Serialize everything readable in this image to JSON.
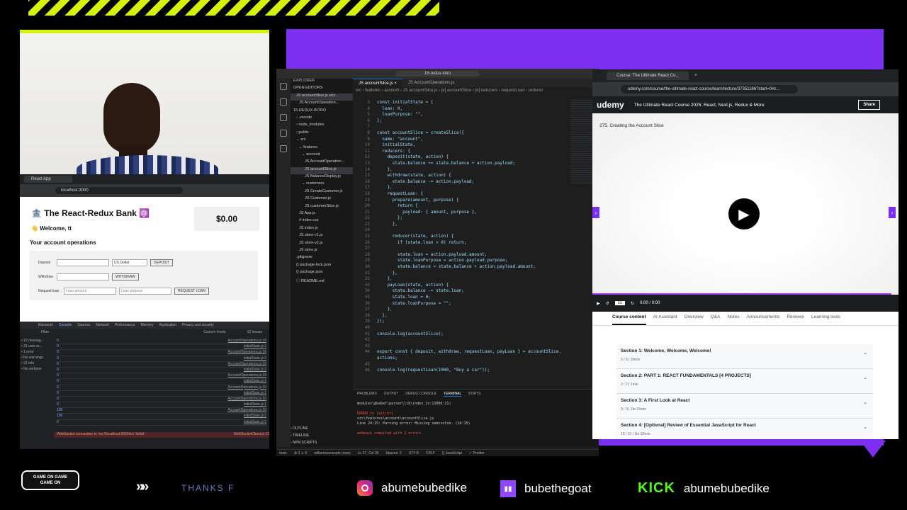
{
  "react_app": {
    "tab_title": "React App",
    "url": "localhost:3000",
    "heading": "🏦 The React-Redux Bank ⚛️",
    "welcome": "👋 Welcome, tt",
    "ops_title": "Your account operations",
    "balance": "$0.00",
    "deposit_label": "Deposit",
    "currency": "US Dollar",
    "deposit_btn": "DEPOSIT",
    "withdraw_label": "Withdraw",
    "withdraw_btn": "WITHDRAW",
    "loan_label": "Request loan",
    "loan_amount_ph": "Loan amount",
    "loan_purpose_ph": "Loan purpose",
    "loan_btn": "REQUEST LOAN"
  },
  "devtools": {
    "tabs": [
      "Elements",
      "Console",
      "Sources",
      "Network",
      "Performance",
      "Memory",
      "Application",
      "Privacy and security"
    ],
    "filter_placeholder": "Filter",
    "levels": "Custom levels",
    "issues": "12 Issues",
    "sidebar": [
      "22 messag...",
      "21 user m...",
      "1 error",
      "No warnings",
      "21 info",
      "No verbose"
    ],
    "log_rows": [
      {
        "v": "0",
        "src": "AccountOperations.js:16"
      },
      {
        "v": "0",
        "src": "initialState.js:1"
      },
      {
        "v": "0",
        "src": "AccountOperations.js:16"
      },
      {
        "v": "0",
        "src": "initialState.js:1"
      },
      {
        "v": "0",
        "src": "AccountOperations.js:16"
      },
      {
        "v": "0",
        "src": "initialState.js:1"
      },
      {
        "v": "0",
        "src": "AccountOperations.js:16"
      },
      {
        "v": "0",
        "src": "initialState.js:1"
      },
      {
        "v": "0",
        "src": "AccountOperations.js:16"
      },
      {
        "v": "0",
        "src": "initialState.js:1"
      },
      {
        "v": "0",
        "src": "AccountOperations.js:16"
      },
      {
        "v": "0",
        "src": "initialState.js:1"
      },
      {
        "v": "100",
        "src": "AccountOperations.js:16"
      },
      {
        "v": "100",
        "src": "initialState.js:1"
      },
      {
        "v": "0",
        "src": "initialState.js:1"
      }
    ],
    "error": "WebSocket connection to 'ws://localhost:3000/ws' failed:",
    "error_src": "WebSocketClient.js:13"
  },
  "vscode": {
    "search": "15-redux-intro",
    "explorer_title": "EXPLORER",
    "tree": [
      {
        "t": "OPEN EDITORS",
        "i": 0
      },
      {
        "t": "JS accountSlice.js src/...",
        "i": 1,
        "sel": true
      },
      {
        "t": "JS AccountOperation...",
        "i": 2
      },
      {
        "t": "15-REDUX-INTRO",
        "i": 0
      },
      {
        "t": "› .vscode",
        "i": 1
      },
      {
        "t": "› node_modules",
        "i": 1
      },
      {
        "t": "› public",
        "i": 1
      },
      {
        "t": "⌄ src",
        "i": 1
      },
      {
        "t": "⌄ features",
        "i": 2
      },
      {
        "t": "⌄ account",
        "i": 3
      },
      {
        "t": "JS AccountOperation...",
        "i": 4
      },
      {
        "t": "JS accountSlice.js",
        "i": 4,
        "sel": true
      },
      {
        "t": "JS BalanceDisplay.js",
        "i": 4
      },
      {
        "t": "⌄ customers",
        "i": 3
      },
      {
        "t": "JS CreateCustomer.js",
        "i": 4
      },
      {
        "t": "JS Customer.js",
        "i": 4
      },
      {
        "t": "JS customerSlice.js",
        "i": 4
      },
      {
        "t": "JS App.js",
        "i": 2
      },
      {
        "t": "# index.css",
        "i": 2
      },
      {
        "t": "JS index.js",
        "i": 2
      },
      {
        "t": "JS store-v1.js",
        "i": 2
      },
      {
        "t": "JS store-v2.js",
        "i": 2
      },
      {
        "t": "JS store.js",
        "i": 2
      },
      {
        "t": ".gitignore",
        "i": 1
      },
      {
        "t": "{} package-lock.json",
        "i": 1
      },
      {
        "t": "{} package.json",
        "i": 1
      },
      {
        "t": "ⓘ README.md",
        "i": 1
      }
    ],
    "tabs": [
      "JS accountSlice.js ×",
      "JS AccountOperations.js"
    ],
    "breadcrumb": "src › features › account › JS accountSlice.js › [e] accountSlice › [e] reducers › requestLoan › reducer",
    "code": [
      [
        "3",
        "const initialState = {"
      ],
      [
        "4",
        "  loan: 0,"
      ],
      [
        "5",
        "  loanPurpose: \"\","
      ],
      [
        "6",
        "};"
      ],
      [
        "7",
        ""
      ],
      [
        "8",
        "const accountSlice = createSlice({"
      ],
      [
        "9",
        "  name: \"account\","
      ],
      [
        "10",
        "  initialState,"
      ],
      [
        "11",
        "  reducers: {"
      ],
      [
        "12",
        "    deposit(state, action) {"
      ],
      [
        "13",
        "      state.balance += state.balance + action.payload;"
      ],
      [
        "14",
        "    },"
      ],
      [
        "15",
        "    withdraw(state, action) {"
      ],
      [
        "16",
        "      state.balance -= action.payload;"
      ],
      [
        "17",
        "    },"
      ],
      [
        "18",
        "    requestLoan: {"
      ],
      [
        "19",
        "      prepare(amount, purpose) {"
      ],
      [
        "20",
        "        return {"
      ],
      [
        "21",
        "          payload: { amount, purpose },"
      ],
      [
        "22",
        "        };"
      ],
      [
        "23",
        "      },"
      ],
      [
        "24",
        ""
      ],
      [
        "25",
        "      reducer(state, action) {"
      ],
      [
        "26",
        "        if (state.loan > 0) return;"
      ],
      [
        "27",
        ""
      ],
      [
        "28",
        "        state.loan = action.payload.amount;"
      ],
      [
        "29",
        "        state.loanPurpose = action.payload.purpose;"
      ],
      [
        "30",
        "        state.balance = state.balance + action.payload.amount;"
      ],
      [
        "31",
        "      },"
      ],
      [
        "32",
        "    },"
      ],
      [
        "33",
        "    payLoan(state, action) {"
      ],
      [
        "34",
        "      state.balance -= state.loan;"
      ],
      [
        "35",
        "      state.loan = 0;"
      ],
      [
        "36",
        "      state.loanPurpose = \"\";"
      ],
      [
        "37",
        "    },"
      ],
      [
        "38",
        "  },"
      ],
      [
        "39",
        "});"
      ],
      [
        "40",
        ""
      ],
      [
        "41",
        "console.log(accountSlice);"
      ],
      [
        "42",
        ""
      ],
      [
        "43",
        ""
      ],
      [
        "44",
        "export const { deposit, withdraw, requestLoan, payLoan } = accountSlice."
      ],
      [
        "",
        "actions;"
      ],
      [
        "45",
        ""
      ],
      [
        "46",
        "console.log(requestLoan(1000, \"Buy a car\"));"
      ]
    ],
    "panel_tabs": [
      "PROBLEMS",
      "OUTPUT",
      "DEBUG CONSOLE",
      "TERMINAL",
      "PORTS"
    ],
    "terminal": [
      "modules\\@babel\\parser\\lib\\index.js:11066:21)",
      "",
      "ERROR in [eslint]",
      "src\\features\\account\\accountSlice.js",
      "  Line 24:15:  Parsing error: Missing semicolon. (24:15)",
      "",
      "webpack compiled with 2 errors"
    ],
    "outline": [
      "› OUTLINE",
      "› TIMELINE",
      "› NPM SCRIPTS"
    ],
    "status": [
      "main",
      "⊗ 0 ⚠ 0",
      "williamsconcepts (now)",
      "Ln 27, Col 36",
      "Spaces: 2",
      "UTF-8",
      "CRLF",
      "{} JavaScript",
      "✓ Prettier"
    ]
  },
  "udemy": {
    "tab_title": "Course: The Ultimate React Co...",
    "url": "udemy.com/course/the-ultimate-react-course/learn/lecture/37351166?start=0#c...",
    "logo": "udemy",
    "course_title": "The Ultimate React Course 2025: React, Next.js, Redux & More",
    "share": "Share",
    "lecture": "275. Creating the Account Slice",
    "speed": "1x",
    "time": "0:00 / 0:00",
    "tabs": [
      "Course content",
      "AI Assistant",
      "Overview",
      "Q&A",
      "Notes",
      "Announcements",
      "Reviews",
      "Learning tools"
    ],
    "sections": [
      {
        "title": "Section 1: Welcome, Welcome, Welcome!",
        "meta": "5 / 5 | 39min"
      },
      {
        "title": "Section 2: PART 1: REACT FUNDAMENTALS [4 PROJECTS]",
        "meta": "2 / 2 | 1min"
      },
      {
        "title": "Section 3: A First Look at React",
        "meta": "9 / 9 | 1hr 15min"
      },
      {
        "title": "Section 4: [Optional] Review of Essential JavaScript for React",
        "meta": "10 / 10 | 1hr 52min"
      }
    ]
  },
  "footer": {
    "logo_top": "GAME ON GAME",
    "logo_bottom": "GAME ON",
    "chevrons": "»»",
    "thanks": "THANKS F",
    "instagram": "abumebubedike",
    "twitch": "bubethegoat",
    "kick_label": "KICK",
    "kick": "abumebubedike"
  },
  "colors": {
    "accent_yellow": "#d7f20a",
    "purple": "#7b2ff0",
    "kick_green": "#53fc18"
  }
}
